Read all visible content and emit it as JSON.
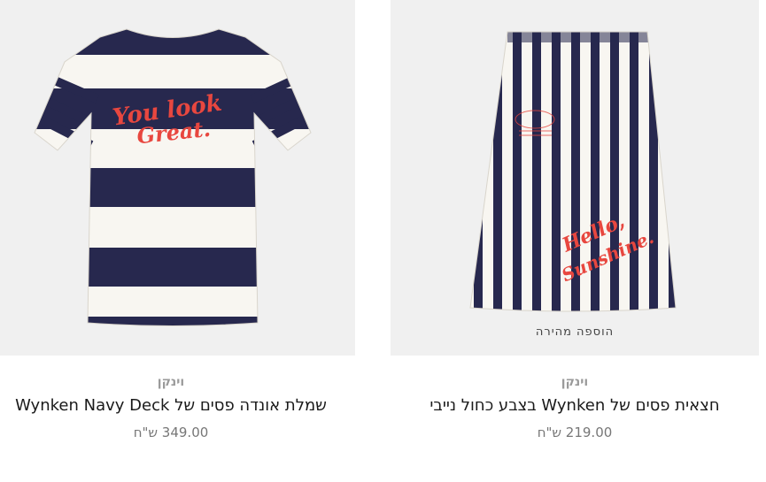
{
  "products": [
    {
      "brand": "וינקן",
      "title": "שמלת אונדה פסים של Wynken Navy Deck",
      "price": "349.00 ש\"ח",
      "print_text_1": "You look",
      "print_text_2": "Great."
    },
    {
      "brand": "וינקן",
      "title": "חצאית פסים של Wynken בצבע כחול נייבי",
      "price": "219.00 ש\"ח",
      "quick_add": "הוספה מהירה",
      "print_text_1": "Hello,",
      "print_text_2": "Sunshine."
    }
  ],
  "colors": {
    "navy": "#27284e",
    "cream": "#f8f6f1",
    "print_red": "#e8473f",
    "image_bg": "#f0f0f0"
  }
}
